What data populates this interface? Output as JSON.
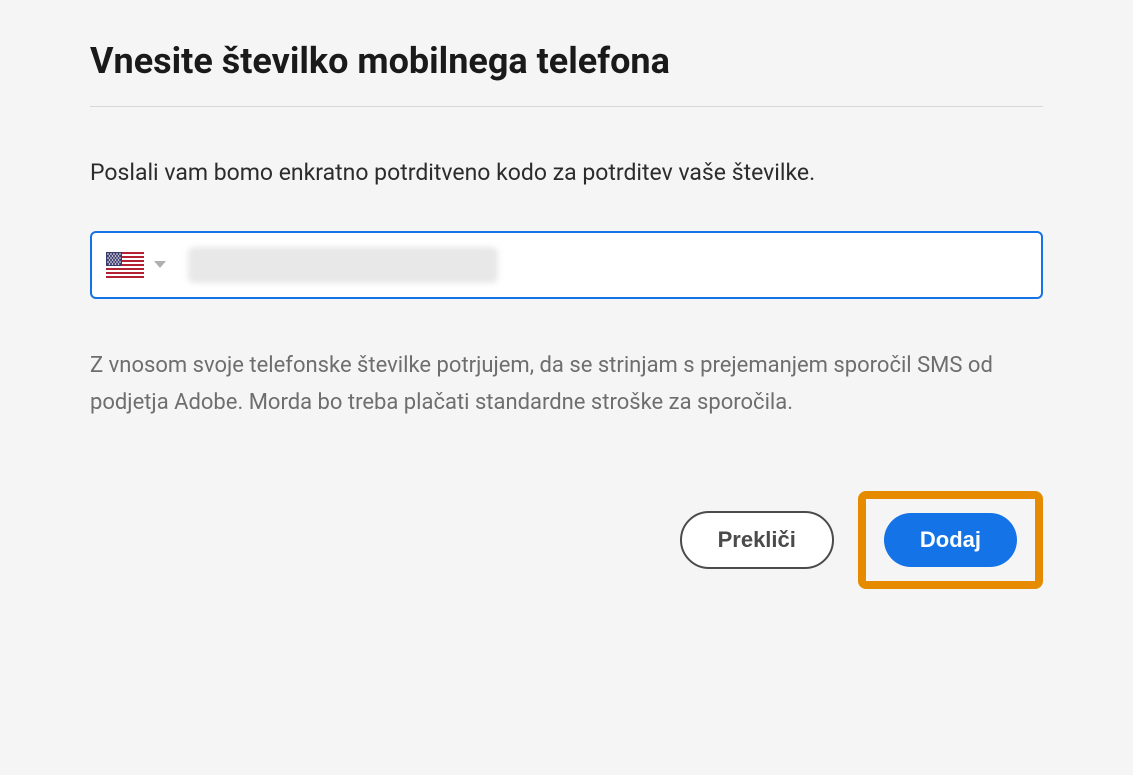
{
  "header": {
    "title": "Vnesite številko mobilnega telefona"
  },
  "body": {
    "description": "Poslali vam bomo enkratno potrditveno kodo za potrditev vaše številke.",
    "disclaimer": "Z vnosom svoje telefonske številke potrjujem, da se strinjam s prejemanjem sporočil SMS od podjetja Adobe. Morda bo treba plačati standardne stroške za sporočila."
  },
  "phone": {
    "country": "US",
    "value": ""
  },
  "buttons": {
    "cancel": "Prekliči",
    "add": "Dodaj"
  }
}
